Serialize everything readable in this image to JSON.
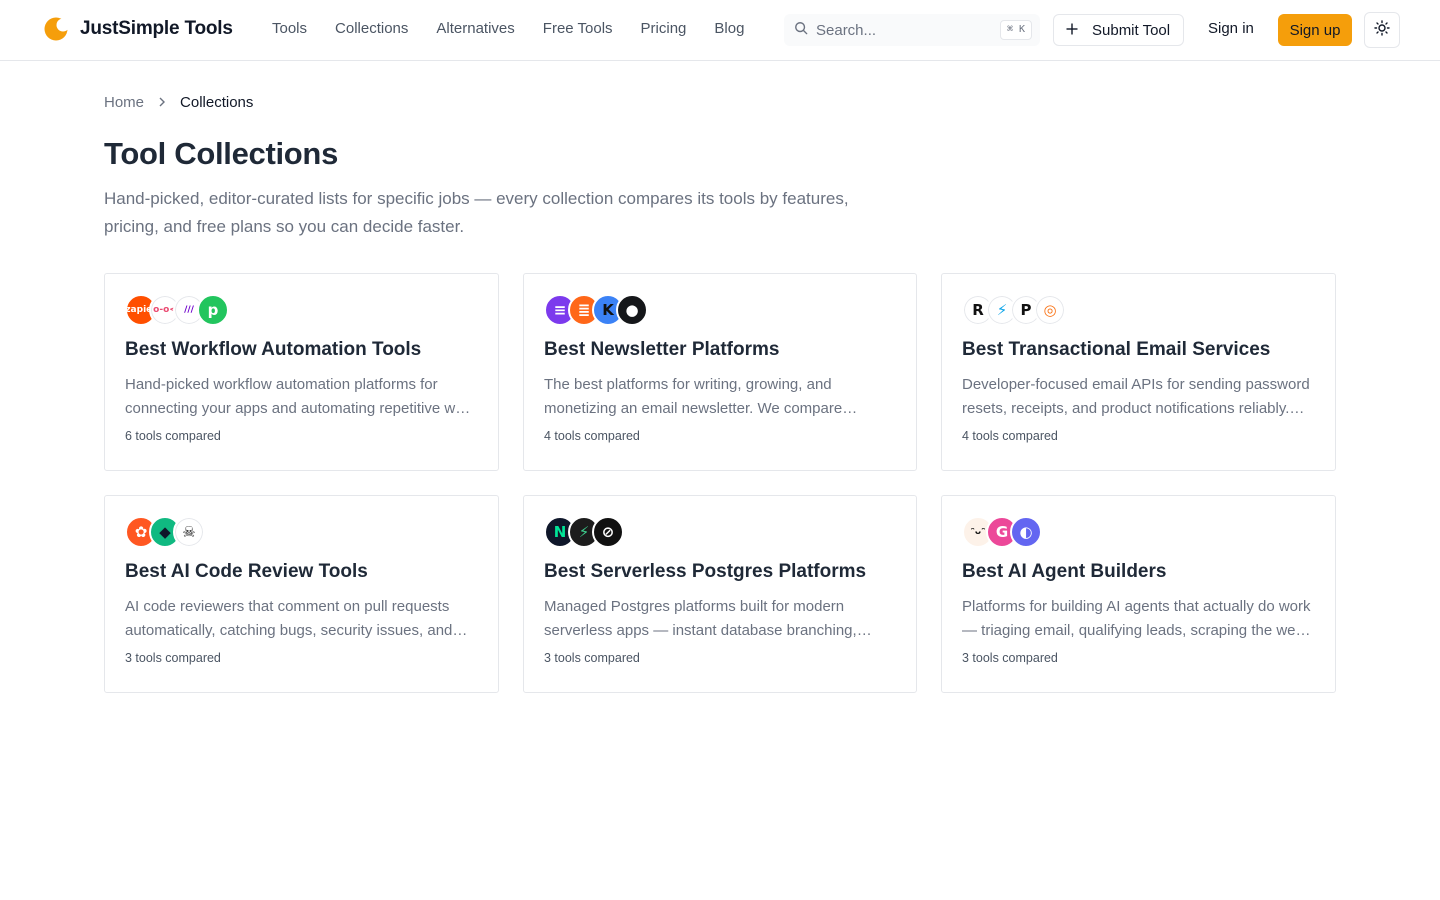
{
  "brand": {
    "name": "JustSimple Tools",
    "accent": "#f59e0b"
  },
  "nav": {
    "items": [
      "Tools",
      "Collections",
      "Alternatives",
      "Free Tools",
      "Pricing",
      "Blog"
    ]
  },
  "search": {
    "placeholder": "Search...",
    "shortcut": "⌘ K"
  },
  "header_actions": {
    "submit_label": "Submit Tool",
    "signin_label": "Sign in",
    "signup_label": "Sign up"
  },
  "breadcrumb": {
    "home": "Home",
    "current": "Collections"
  },
  "page": {
    "title": "Tool Collections",
    "description": "Hand-picked, editor-curated lists for specific jobs — every collection compares its tools by features, pricing, and free plans so you can decide faster."
  },
  "collections": [
    {
      "title": "Best Workflow Automation Tools",
      "description": "Hand-picked workflow automation platforms for connecting your apps and automating repetitive work across your stack.",
      "count": "6 tools compared",
      "avatars": [
        {
          "icon": "zapier-logo-icon",
          "bg": "#ff4f00",
          "fg": "#ffffff",
          "label": "zapier"
        },
        {
          "icon": "n8n-logo-icon",
          "bg": "#ffffff",
          "fg": "#ea4b71",
          "label": "o-o<"
        },
        {
          "icon": "make-logo-icon",
          "bg": "#ffffff",
          "fg": "#6d00cc",
          "label": "///"
        },
        {
          "icon": "pipedream-logo-icon",
          "bg": "#22c55e",
          "fg": "#ffffff",
          "label": "p"
        }
      ]
    },
    {
      "title": "Best Newsletter Platforms",
      "description": "The best platforms for writing, growing, and monetizing an email newsletter. We compare beehiiv, Substack, Kit and Ghost.",
      "count": "4 tools compared",
      "avatars": [
        {
          "icon": "beehiiv-logo-icon",
          "bg": "#7c3aed",
          "fg": "#ffffff",
          "label": "≡"
        },
        {
          "icon": "substack-logo-icon",
          "bg": "#ff6719",
          "fg": "#ffffff",
          "label": "≣"
        },
        {
          "icon": "kit-logo-icon",
          "bg": "#3b82f6",
          "fg": "#111111",
          "label": "K"
        },
        {
          "icon": "ghost-logo-icon",
          "bg": "#15171a",
          "fg": "#ffffff",
          "label": "●"
        }
      ]
    },
    {
      "title": "Best Transactional Email Services",
      "description": "Developer-focused email APIs for sending password resets, receipts, and product notifications reliably. We compare deliverability.",
      "count": "4 tools compared",
      "avatars": [
        {
          "icon": "resend-logo-icon",
          "bg": "#ffffff",
          "fg": "#111111",
          "label": "R"
        },
        {
          "icon": "mailtrap-logo-icon",
          "bg": "#ffffff",
          "fg": "#0ea5e9",
          "label": "⚡"
        },
        {
          "icon": "postmark-logo-icon",
          "bg": "#ffffff",
          "fg": "#111111",
          "label": "P"
        },
        {
          "icon": "mailgun-logo-icon",
          "bg": "#ffffff",
          "fg": "#f97316",
          "label": "◎"
        }
      ]
    },
    {
      "title": "Best AI Code Review Tools",
      "description": "AI code reviewers that comment on pull requests automatically, catching bugs, security issues, and style problems early.",
      "count": "3 tools compared",
      "avatars": [
        {
          "icon": "coderabbit-logo-icon",
          "bg": "#ff5722",
          "fg": "#ffffff",
          "label": "✿"
        },
        {
          "icon": "codeant-logo-icon",
          "bg": "#10b981",
          "fg": "#0f172a",
          "label": "◆"
        },
        {
          "icon": "graphite-logo-icon",
          "bg": "#ffffff",
          "fg": "#111111",
          "label": "☠"
        }
      ]
    },
    {
      "title": "Best Serverless Postgres Platforms",
      "description": "Managed Postgres platforms built for modern serverless apps — instant database branching, autoscaling and scale-to-zero.",
      "count": "3 tools compared",
      "avatars": [
        {
          "icon": "neon-logo-icon",
          "bg": "#0f172a",
          "fg": "#00e599",
          "label": "N"
        },
        {
          "icon": "supabase-logo-icon",
          "bg": "#1c1c1c",
          "fg": "#3ecf8e",
          "label": "⚡"
        },
        {
          "icon": "prisma-logo-icon",
          "bg": "#111111",
          "fg": "#ffffff",
          "label": "⊘"
        }
      ]
    },
    {
      "title": "Best AI Agent Builders",
      "description": "Platforms for building AI agents that actually do work — triaging email, qualifying leads, scraping the web and more.",
      "count": "3 tools compared",
      "avatars": [
        {
          "icon": "lindy-logo-icon",
          "bg": "#fdf2e9",
          "fg": "#111111",
          "label": "ᵔᴗᵔ"
        },
        {
          "icon": "gumloop-logo-icon",
          "bg": "#ec4899",
          "fg": "#ffffff",
          "label": "G"
        },
        {
          "icon": "relevance-logo-icon",
          "bg": "#6366f1",
          "fg": "#ffffff",
          "label": "◐"
        }
      ]
    }
  ]
}
